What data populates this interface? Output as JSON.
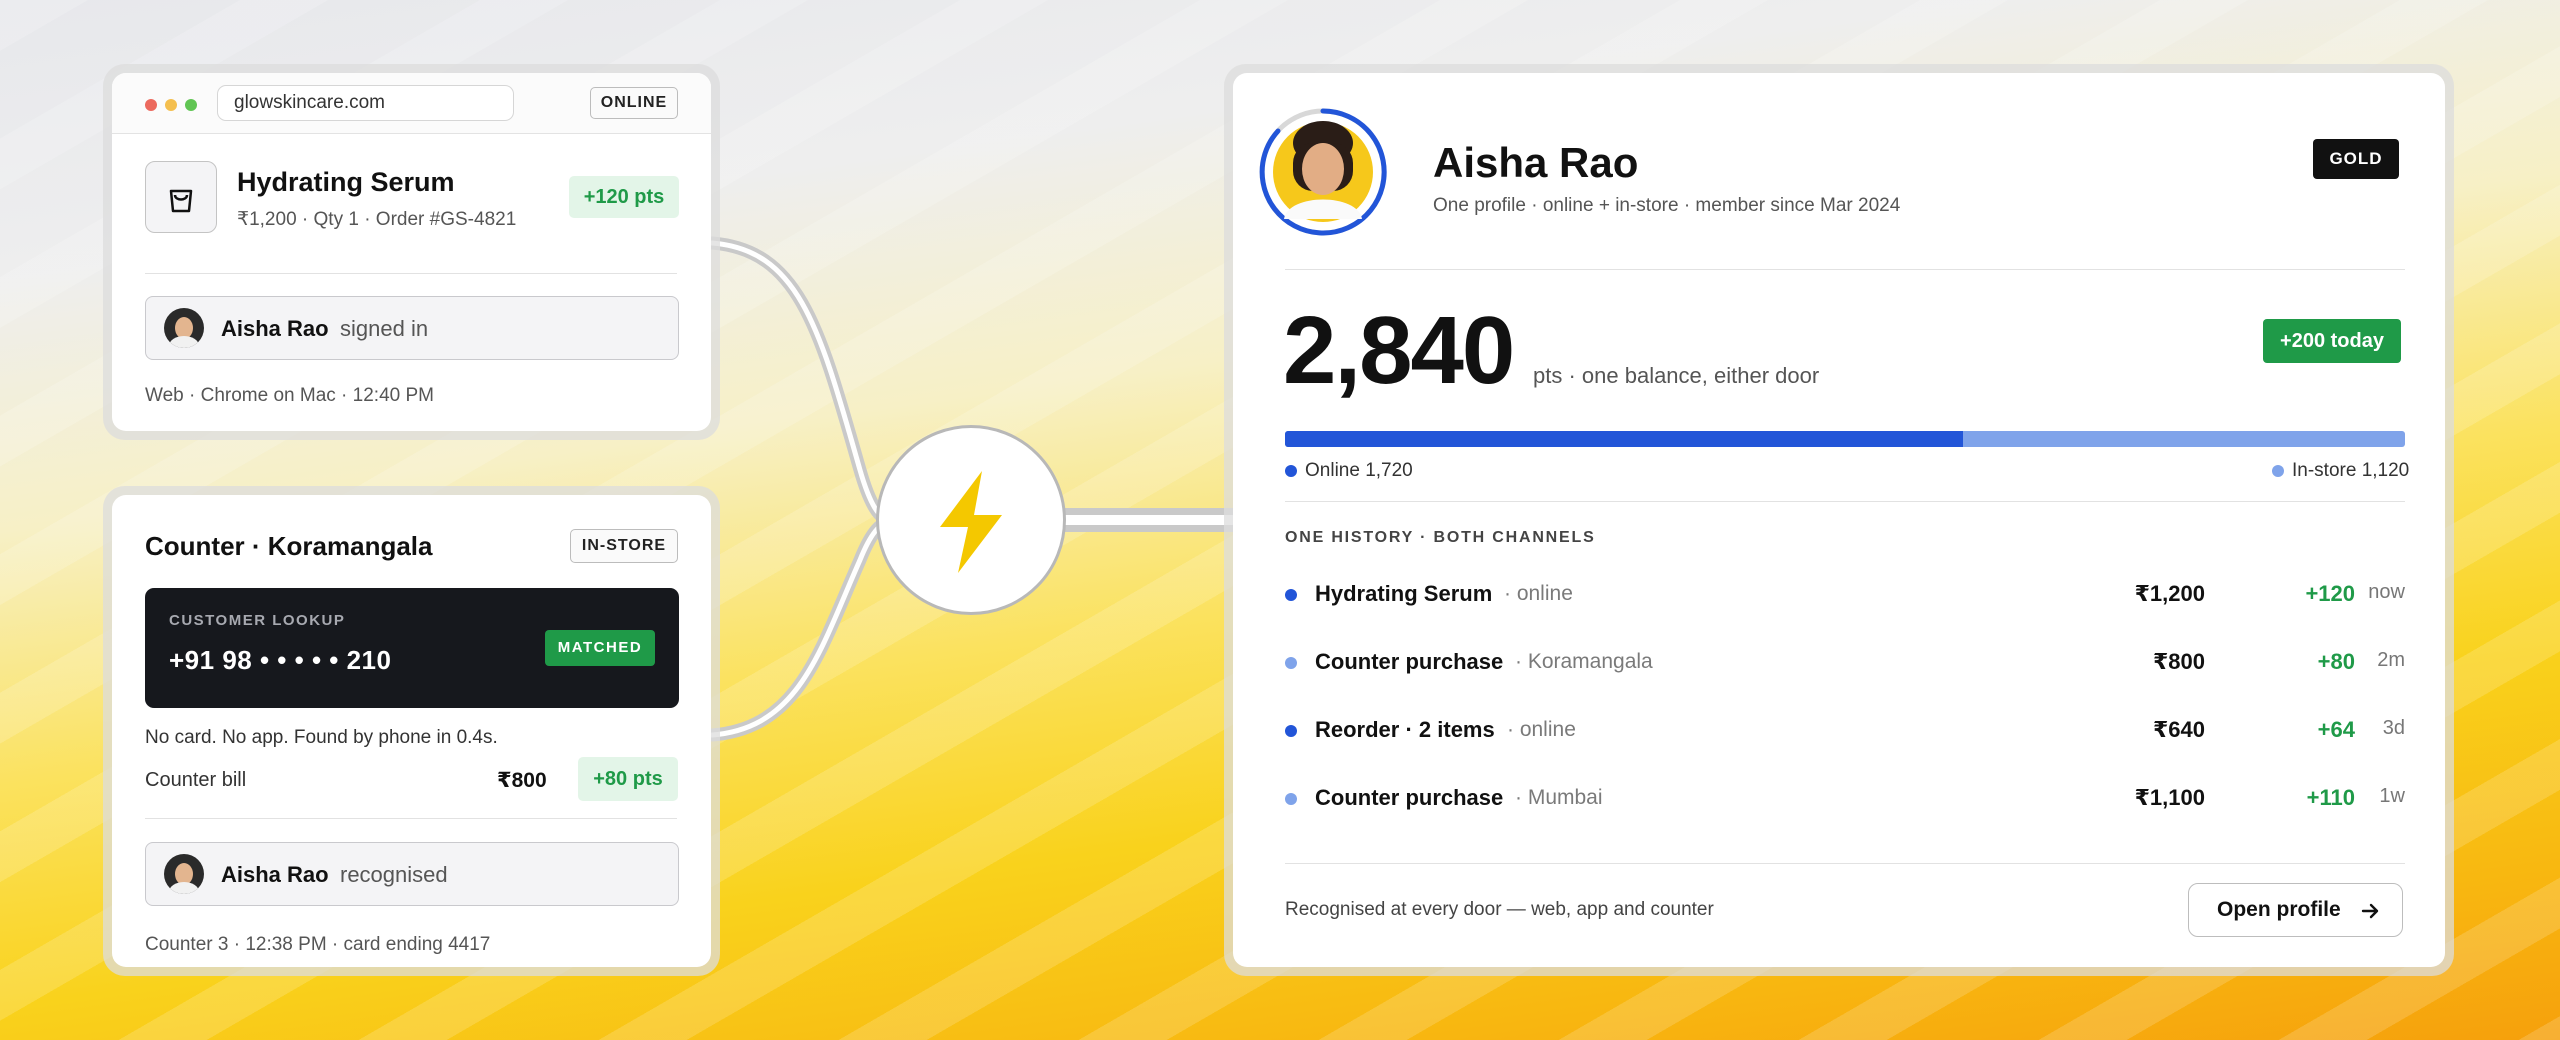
{
  "online_card": {
    "url": "glowskincare.com",
    "channel_tag": "ONLINE",
    "product_title": "Hydrating Serum",
    "product_meta": "₹1,200 · Qty 1 · Order #GS-4821",
    "points_badge": "+120 pts",
    "customer_name": "Aisha Rao",
    "action": "signed in",
    "footer": "Web · Chrome on Mac · 12:40 PM"
  },
  "store_card": {
    "title": "Counter · Koramangala",
    "channel_tag": "IN-STORE",
    "lookup_label": "CUSTOMER LOOKUP",
    "lookup_phone": "+91 98 • • • • • 210",
    "matched_badge": "MATCHED",
    "note": "No card. No app. Found by phone in 0.4s.",
    "bill_label": "Counter bill",
    "bill_amount": "₹800",
    "points_badge": "+80 pts",
    "customer_name": "Aisha Rao",
    "action": "recognised",
    "footer": "Counter 3 · 12:38 PM · card ending 4417"
  },
  "profile": {
    "name": "Aisha Rao",
    "subtitle": "One profile · online + in-store · member since Mar 2024",
    "tier_badge": "GOLD",
    "points": "2,840",
    "points_caption": "pts · one balance, either door",
    "today_badge": "+200 today",
    "balance_split": {
      "online": 1720,
      "instore": 1120
    },
    "online_legend": "Online 1,720",
    "instore_legend": "In-store 1,120",
    "history_heading": "ONE HISTORY · BOTH CHANNELS",
    "history": [
      {
        "name": "Hydrating Serum",
        "channel": "· online",
        "amount": "₹1,200",
        "points": "+120",
        "when": "now",
        "kind": "online"
      },
      {
        "name": "Counter purchase",
        "channel": "· Koramangala",
        "amount": "₹800",
        "points": "+80",
        "when": "2m",
        "kind": "instore"
      },
      {
        "name": "Reorder · 2 items",
        "channel": "· online",
        "amount": "₹640",
        "points": "+64",
        "when": "3d",
        "kind": "online"
      },
      {
        "name": "Counter purchase",
        "channel": "· Mumbai",
        "amount": "₹1,100",
        "points": "+110",
        "when": "1w",
        "kind": "instore"
      }
    ],
    "footer_note": "Recognised at every door — web, app and counter",
    "open_button": "Open profile"
  },
  "colors": {
    "online": "#2255d8",
    "instore": "#7fa3ea",
    "green": "#1f9a48",
    "bolt": "#f4c800"
  }
}
